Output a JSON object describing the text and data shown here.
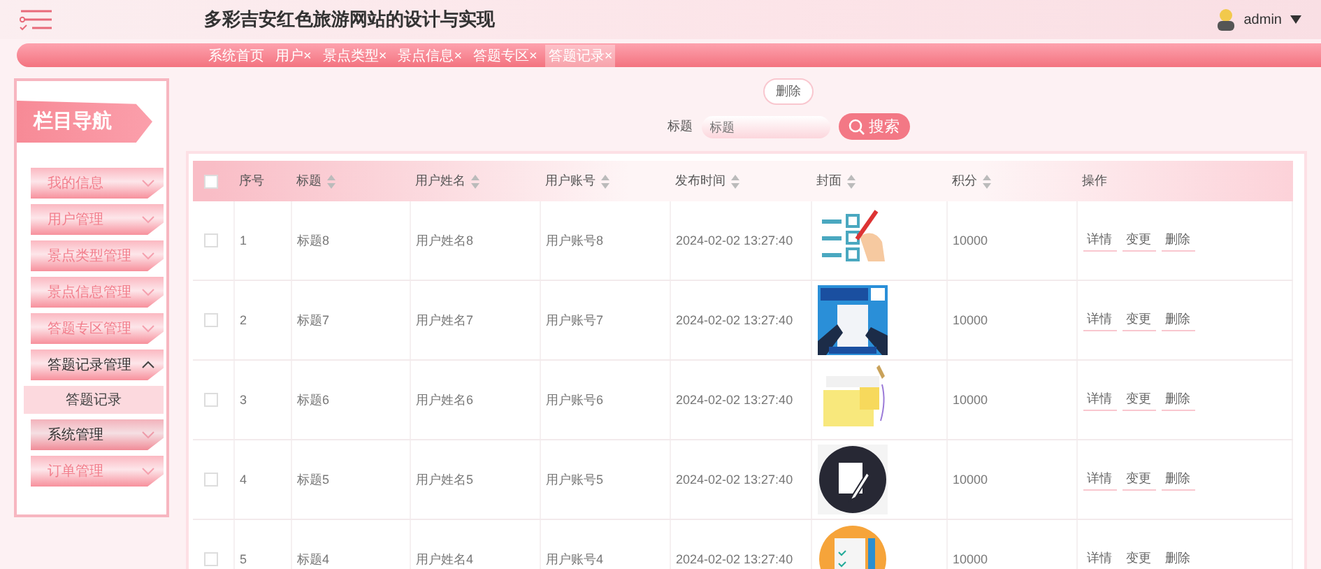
{
  "header": {
    "title": "多彩吉安红色旅游网站的设计与实现",
    "user": "admin"
  },
  "tabs": [
    {
      "label": "系统首页",
      "closable": false,
      "selected": false
    },
    {
      "label": "用户",
      "closable": true,
      "selected": false
    },
    {
      "label": "景点类型",
      "closable": true,
      "selected": false
    },
    {
      "label": "景点信息",
      "closable": true,
      "selected": false
    },
    {
      "label": "答题专区",
      "closable": true,
      "selected": false
    },
    {
      "label": "答题记录",
      "closable": true,
      "selected": true
    }
  ],
  "close_mark": "×",
  "sidebar": {
    "title": "栏目导航",
    "items": [
      {
        "label": "我的信息",
        "expanded": false,
        "hovered": false
      },
      {
        "label": "用户管理",
        "expanded": false,
        "hovered": false
      },
      {
        "label": "景点类型管理",
        "expanded": false,
        "hovered": false
      },
      {
        "label": "景点信息管理",
        "expanded": false,
        "hovered": false
      },
      {
        "label": "答题专区管理",
        "expanded": false,
        "hovered": false
      },
      {
        "label": "答题记录管理",
        "expanded": true,
        "hovered": false,
        "children": [
          {
            "label": "答题记录"
          }
        ]
      },
      {
        "label": "系统管理",
        "expanded": false,
        "hovered": true
      },
      {
        "label": "订单管理",
        "expanded": false,
        "hovered": false
      }
    ]
  },
  "toolbar": {
    "delete_button": "删除",
    "search_label": "标题",
    "search_placeholder": "标题",
    "search_button": "搜索"
  },
  "table": {
    "select_all_checked": false,
    "columns": [
      {
        "label": "序号",
        "sortable": false
      },
      {
        "label": "标题",
        "sortable": true
      },
      {
        "label": "用户姓名",
        "sortable": true
      },
      {
        "label": "用户账号",
        "sortable": true
      },
      {
        "label": "发布时间",
        "sortable": true
      },
      {
        "label": "封面",
        "sortable": true
      },
      {
        "label": "积分",
        "sortable": true
      },
      {
        "label": "操作",
        "sortable": false
      }
    ],
    "rows": [
      {
        "index": "1",
        "title": "标题8",
        "name": "用户姓名8",
        "account": "用户账号8",
        "time": "2024-02-02 13:27:40",
        "points": "10000",
        "checked": false,
        "actions": [
          "详情",
          "变更",
          "删除"
        ]
      },
      {
        "index": "2",
        "title": "标题7",
        "name": "用户姓名7",
        "account": "用户账号7",
        "time": "2024-02-02 13:27:40",
        "points": "10000",
        "checked": false,
        "actions": [
          "详情",
          "变更",
          "删除"
        ]
      },
      {
        "index": "3",
        "title": "标题6",
        "name": "用户姓名6",
        "account": "用户账号6",
        "time": "2024-02-02 13:27:40",
        "points": "10000",
        "checked": false,
        "actions": [
          "详情",
          "变更",
          "删除"
        ]
      },
      {
        "index": "4",
        "title": "标题5",
        "name": "用户姓名5",
        "account": "用户账号5",
        "time": "2024-02-02 13:27:40",
        "points": "10000",
        "checked": false,
        "actions": [
          "详情",
          "变更",
          "删除"
        ]
      },
      {
        "index": "5",
        "title": "标题4",
        "name": "用户姓名4",
        "account": "用户账号4",
        "time": "2024-02-02 13:27:40",
        "points": "10000",
        "checked": false,
        "actions": [
          "详情",
          "变更",
          "删除"
        ]
      }
    ]
  }
}
